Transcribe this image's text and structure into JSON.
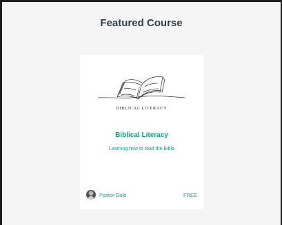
{
  "section": {
    "title": "Featured Course"
  },
  "course": {
    "cover_caption": "BIBLICAL LITERACY",
    "cover_icon": "open-book-icon",
    "title": "Biblical Literacy",
    "subtitle": "Learning how to read the Bible",
    "author": "Pastor Dale",
    "author_avatar": "avatar-photo",
    "price": "FREE"
  },
  "colors": {
    "accent": "#159c8c",
    "background": "#f5f5f5",
    "card": "#ffffff",
    "frame": "#1e1e1e",
    "heading": "#2c3e50"
  }
}
